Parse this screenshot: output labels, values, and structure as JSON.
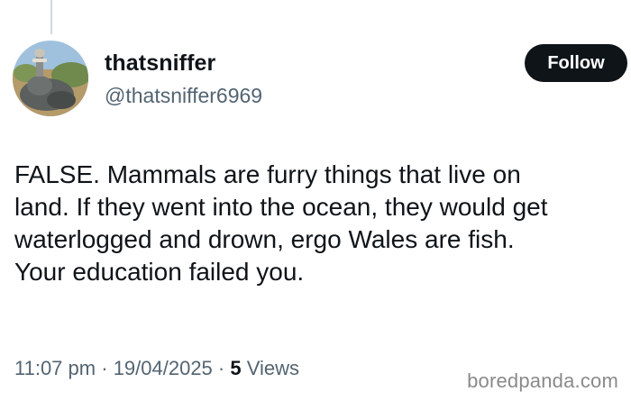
{
  "tweet": {
    "display_name": "thatsniffer",
    "handle": "@thatsniffer6969",
    "follow_label": "Follow",
    "text_lines": [
      "FALSE. Mammals are furry things that live on",
      "land. If they went into the ocean, they would get",
      "waterlogged and drown, ergo Wales are fish.",
      "Your education failed you."
    ],
    "time": "11:07 pm",
    "date": "19/04/2025",
    "separator": "·",
    "views_count": "5",
    "views_label": "Views"
  },
  "watermark": "boredpanda.com",
  "colors": {
    "text": "#0f1419",
    "secondary": "#536471",
    "follow_bg": "#0f1419",
    "thread_line": "#cfd9de"
  },
  "icons": {
    "avatar": "profile-photo"
  }
}
